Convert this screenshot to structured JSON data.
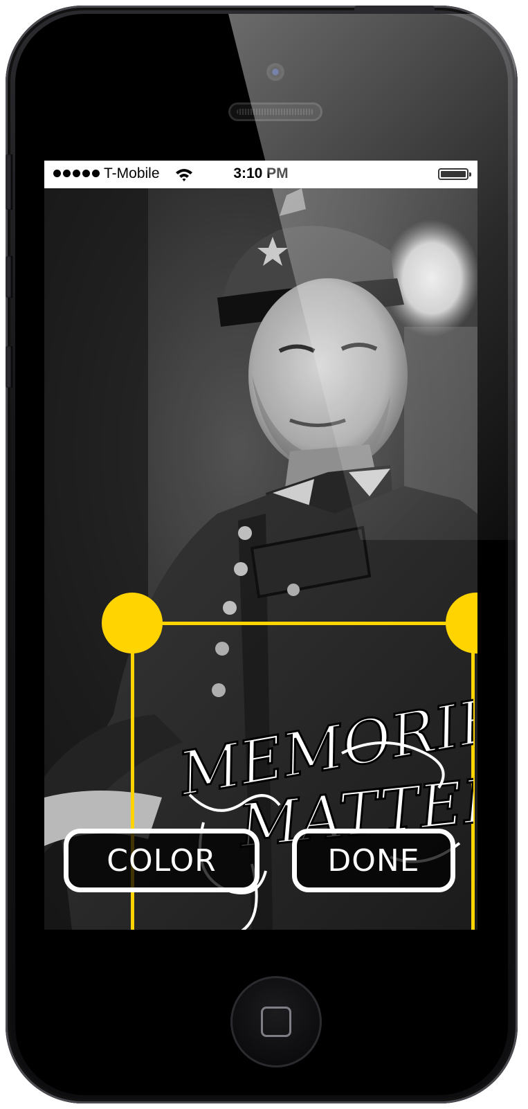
{
  "status_bar": {
    "carrier": "T-Mobile",
    "time": "3:10 PM",
    "signal_bars": 5,
    "battery_level": 1.0
  },
  "overlay": {
    "title_art": "Memories Matter",
    "accent_color": "#ffd400"
  },
  "buttons": {
    "color_label": "COLOR",
    "done_label": "DONE"
  },
  "icons": {
    "wifi": "wifi-icon",
    "battery": "battery-icon",
    "handle": "resize-handle-icon",
    "home": "home-button-icon"
  }
}
